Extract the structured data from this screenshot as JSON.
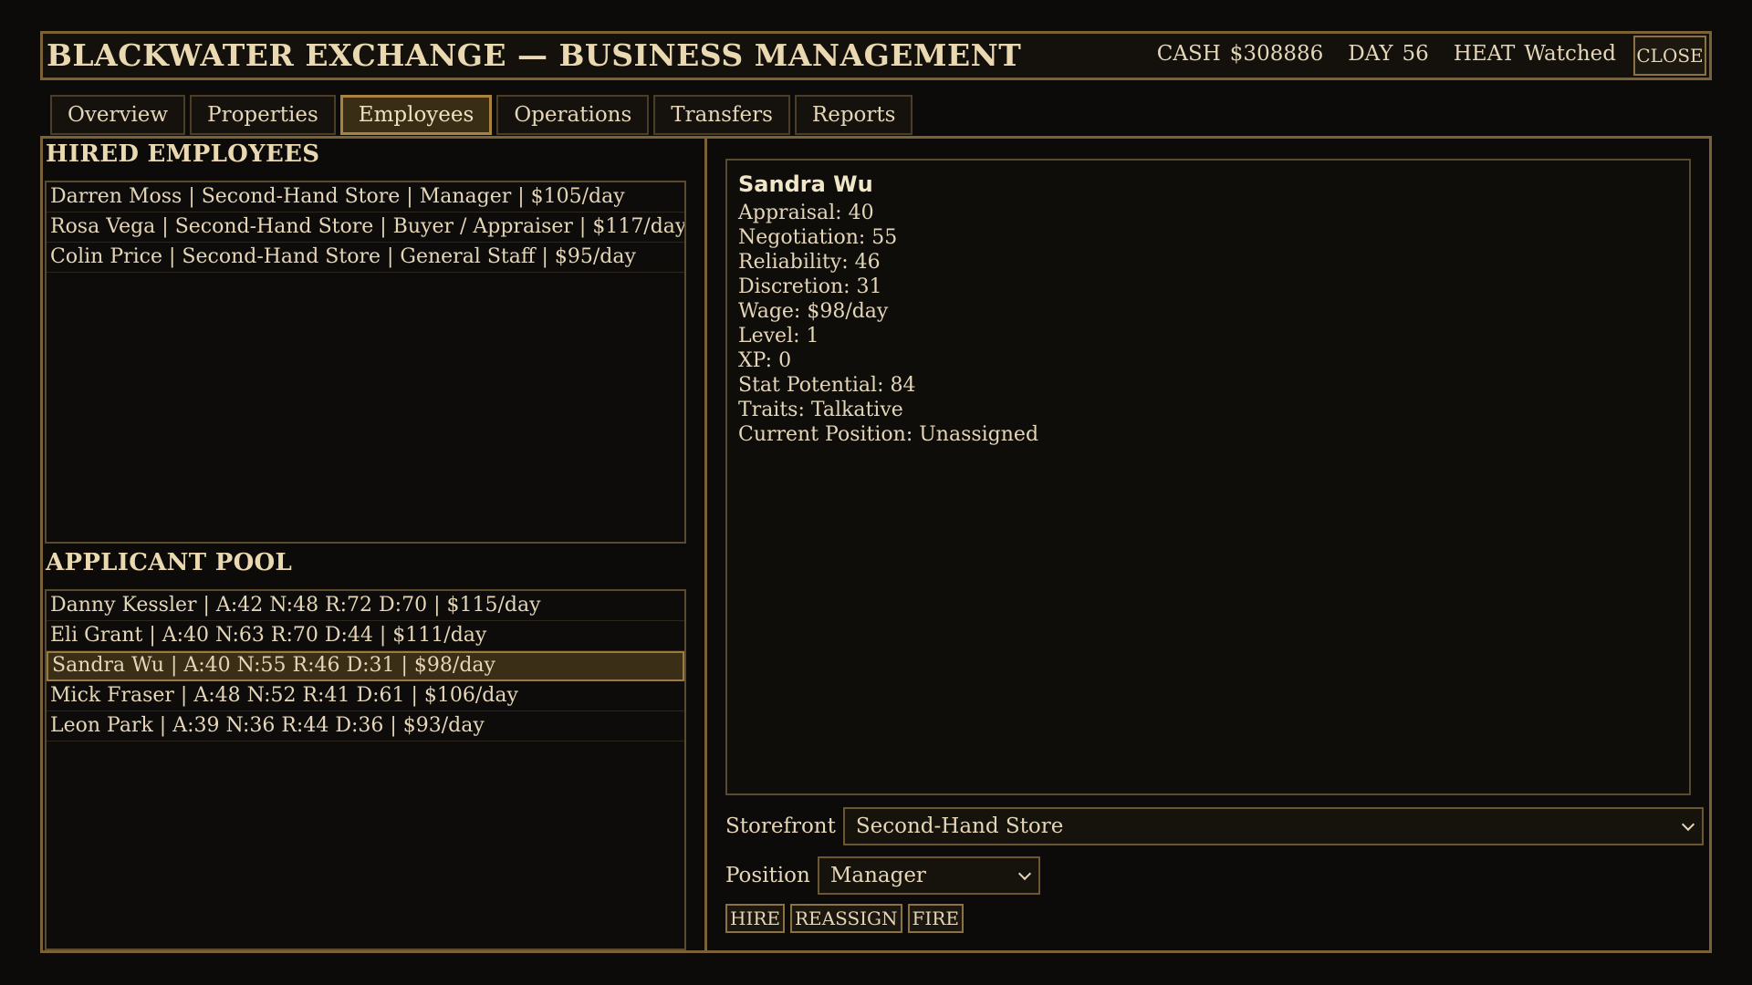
{
  "header": {
    "title": "Blackwater Exchange — Business Management",
    "cash_label": "CASH",
    "cash_value": "$308886",
    "day_label": "DAY",
    "day_value": "56",
    "heat_label": "HEAT",
    "heat_value": "Watched",
    "close_label": "CLOSE"
  },
  "tabs": [
    {
      "label": "Overview"
    },
    {
      "label": "Properties"
    },
    {
      "label": "Employees"
    },
    {
      "label": "Operations"
    },
    {
      "label": "Transfers"
    },
    {
      "label": "Reports"
    }
  ],
  "active_tab": "Employees",
  "hired": {
    "title": "Hired Employees",
    "rows": [
      "Darren Moss | Second-Hand Store | Manager | $105/day",
      "Rosa Vega | Second-Hand Store | Buyer / Appraiser | $117/day",
      "Colin Price | Second-Hand Store | General Staff | $95/day"
    ]
  },
  "applicants": {
    "title": "Applicant Pool",
    "rows": [
      "Danny Kessler | A:42 N:48 R:72 D:70 | $115/day",
      "Eli Grant | A:40 N:63 R:70 D:44 | $111/day",
      "Sandra Wu | A:40 N:55 R:46 D:31 | $98/day",
      "Mick Fraser | A:48 N:52 R:41 D:61 | $106/day",
      "Leon Park | A:39 N:36 R:44 D:36 | $93/day"
    ],
    "selected_index": 2
  },
  "detail": {
    "name": "Sandra Wu",
    "lines": [
      "Appraisal: 40",
      "Negotiation: 55",
      "Reliability: 46",
      "Discretion: 31",
      "Wage: $98/day",
      "Level: 1",
      "XP: 0",
      "Stat Potential: 84",
      "Traits: Talkative",
      "Current Position: Unassigned"
    ]
  },
  "form": {
    "storefront_label": "Storefront",
    "storefront_value": "Second-Hand Store",
    "position_label": "Position",
    "position_value": "Manager"
  },
  "actions": {
    "hire": "HIRE",
    "reassign": "REASSIGN",
    "fire": "FIRE"
  },
  "colors": {
    "accent_border": "#7a6236",
    "selected_bg": "#3b2e17",
    "text": "#e6d6b8",
    "background": "#0c0b09"
  }
}
